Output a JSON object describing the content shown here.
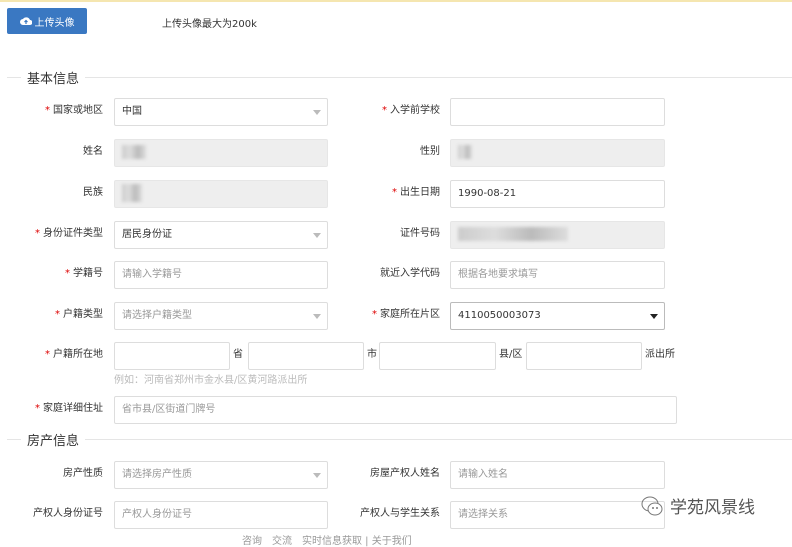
{
  "upload": {
    "label": "上传头像",
    "icon": "cloud-upload-icon",
    "hint": "上传头像最大为200k"
  },
  "sections": {
    "basic": "基本信息",
    "property": "房产信息"
  },
  "fields": {
    "country": {
      "label": "国家或地区",
      "value": "中国"
    },
    "school": {
      "label": "入学前学校",
      "value": ""
    },
    "name": {
      "label": "姓名"
    },
    "gender": {
      "label": "性别"
    },
    "ethnicity": {
      "label": "民族"
    },
    "birth": {
      "label": "出生日期",
      "value": "1990-08-21"
    },
    "id_type": {
      "label": "身份证件类型",
      "value": "居民身份证"
    },
    "id_no": {
      "label": "证件号码"
    },
    "student_no": {
      "label": "学籍号",
      "placeholder": "请输入学籍号"
    },
    "nearby_code": {
      "label": "就近入学代码",
      "placeholder": "根据各地要求填写"
    },
    "hukou_type": {
      "label": "户籍类型",
      "placeholder": "请选择户籍类型"
    },
    "district": {
      "label": "家庭所在片区",
      "value": "4110050003073"
    },
    "hukou_addr": {
      "label": "户籍所在地",
      "units": [
        "省",
        "市",
        "县/区",
        "派出所"
      ],
      "example": "例如：河南省郑州市金水县/区黄河路派出所"
    },
    "home_addr": {
      "label": "家庭详细住址",
      "placeholder": "省市县/区街道门牌号"
    },
    "property_type": {
      "label": "房产性质",
      "placeholder": "请选择房产性质"
    },
    "owner_name": {
      "label": "房屋产权人姓名",
      "placeholder": "请输入姓名"
    },
    "owner_id": {
      "label": "产权人身份证号",
      "placeholder": "产权人身份证号"
    },
    "owner_relation": {
      "label": "产权人与学生关系",
      "placeholder": "请选择关系"
    }
  },
  "footer": "咨询　交流　实时信息获取 | 关于我们",
  "watermark": "学苑风景线",
  "colors": {
    "primary": "#3a78c2",
    "required": "#dd0000"
  }
}
